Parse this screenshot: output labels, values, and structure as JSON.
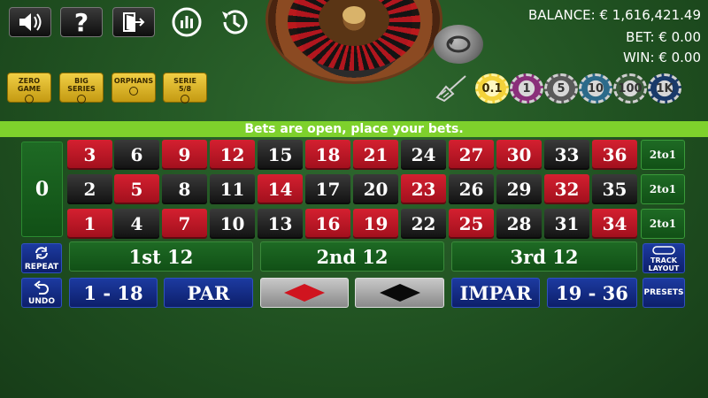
{
  "top_icons": {
    "sound": "speaker-icon",
    "help": "?",
    "exit": "exit-door-icon",
    "stats": "statistics-icon",
    "history": "history-icon"
  },
  "stats": {
    "balance_label": "BALANCE:",
    "balance_value": "€ 1,616,421.49",
    "bet_label": "BET:",
    "bet_value": "€ 0.00",
    "win_label": "WIN:",
    "win_value": "€ 0.00"
  },
  "race_bets": [
    {
      "line1": "ZERO",
      "line2": "GAME"
    },
    {
      "line1": "BIG",
      "line2": "SERIES"
    },
    {
      "line1": "ORPHANS",
      "line2": ""
    },
    {
      "line1": "SERIE",
      "line2": "5/8"
    }
  ],
  "chips": [
    {
      "label": "0.1",
      "color": "#f3d23a",
      "selected": true
    },
    {
      "label": "1",
      "color": "#8a2f7a"
    },
    {
      "label": "5",
      "color": "#5a5a5a"
    },
    {
      "label": "10",
      "color": "#2c6a8a"
    },
    {
      "label": "100",
      "color": "#3a5a3a"
    },
    {
      "label": "1K",
      "color": "#1a3a6a"
    }
  ],
  "banner": "Bets are open, place your bets.",
  "zero": "0",
  "rows": [
    [
      {
        "n": "3",
        "c": "red"
      },
      {
        "n": "6",
        "c": "black"
      },
      {
        "n": "9",
        "c": "red"
      },
      {
        "n": "12",
        "c": "red"
      },
      {
        "n": "15",
        "c": "black"
      },
      {
        "n": "18",
        "c": "red"
      },
      {
        "n": "21",
        "c": "red"
      },
      {
        "n": "24",
        "c": "black"
      },
      {
        "n": "27",
        "c": "red"
      },
      {
        "n": "30",
        "c": "red"
      },
      {
        "n": "33",
        "c": "black"
      },
      {
        "n": "36",
        "c": "red"
      }
    ],
    [
      {
        "n": "2",
        "c": "black"
      },
      {
        "n": "5",
        "c": "red"
      },
      {
        "n": "8",
        "c": "black"
      },
      {
        "n": "11",
        "c": "black"
      },
      {
        "n": "14",
        "c": "red"
      },
      {
        "n": "17",
        "c": "black"
      },
      {
        "n": "20",
        "c": "black"
      },
      {
        "n": "23",
        "c": "red"
      },
      {
        "n": "26",
        "c": "black"
      },
      {
        "n": "29",
        "c": "black"
      },
      {
        "n": "32",
        "c": "red"
      },
      {
        "n": "35",
        "c": "black"
      }
    ],
    [
      {
        "n": "1",
        "c": "red"
      },
      {
        "n": "4",
        "c": "black"
      },
      {
        "n": "7",
        "c": "red"
      },
      {
        "n": "10",
        "c": "black"
      },
      {
        "n": "13",
        "c": "black"
      },
      {
        "n": "16",
        "c": "red"
      },
      {
        "n": "19",
        "c": "red"
      },
      {
        "n": "22",
        "c": "black"
      },
      {
        "n": "25",
        "c": "red"
      },
      {
        "n": "28",
        "c": "black"
      },
      {
        "n": "31",
        "c": "black"
      },
      {
        "n": "34",
        "c": "red"
      }
    ]
  ],
  "column_bets": [
    "2to1",
    "2to1",
    "2to1"
  ],
  "dozens": [
    "1st 12",
    "2nd 12",
    "3rd 12"
  ],
  "outside": {
    "low": "1 - 18",
    "even": "PAR",
    "odd": "IMPAR",
    "high": "19 - 36"
  },
  "buttons": {
    "repeat": "REPEAT",
    "undo": "UNDO",
    "track_layout_1": "TRACK",
    "track_layout_2": "LAYOUT",
    "presets": "PRESETS"
  },
  "colors": {
    "red": "#c41424",
    "black": "#1a1a1a",
    "table_green": "#1f4f20",
    "banner_green": "#7ed12c",
    "blue": "#1c3aa0"
  }
}
